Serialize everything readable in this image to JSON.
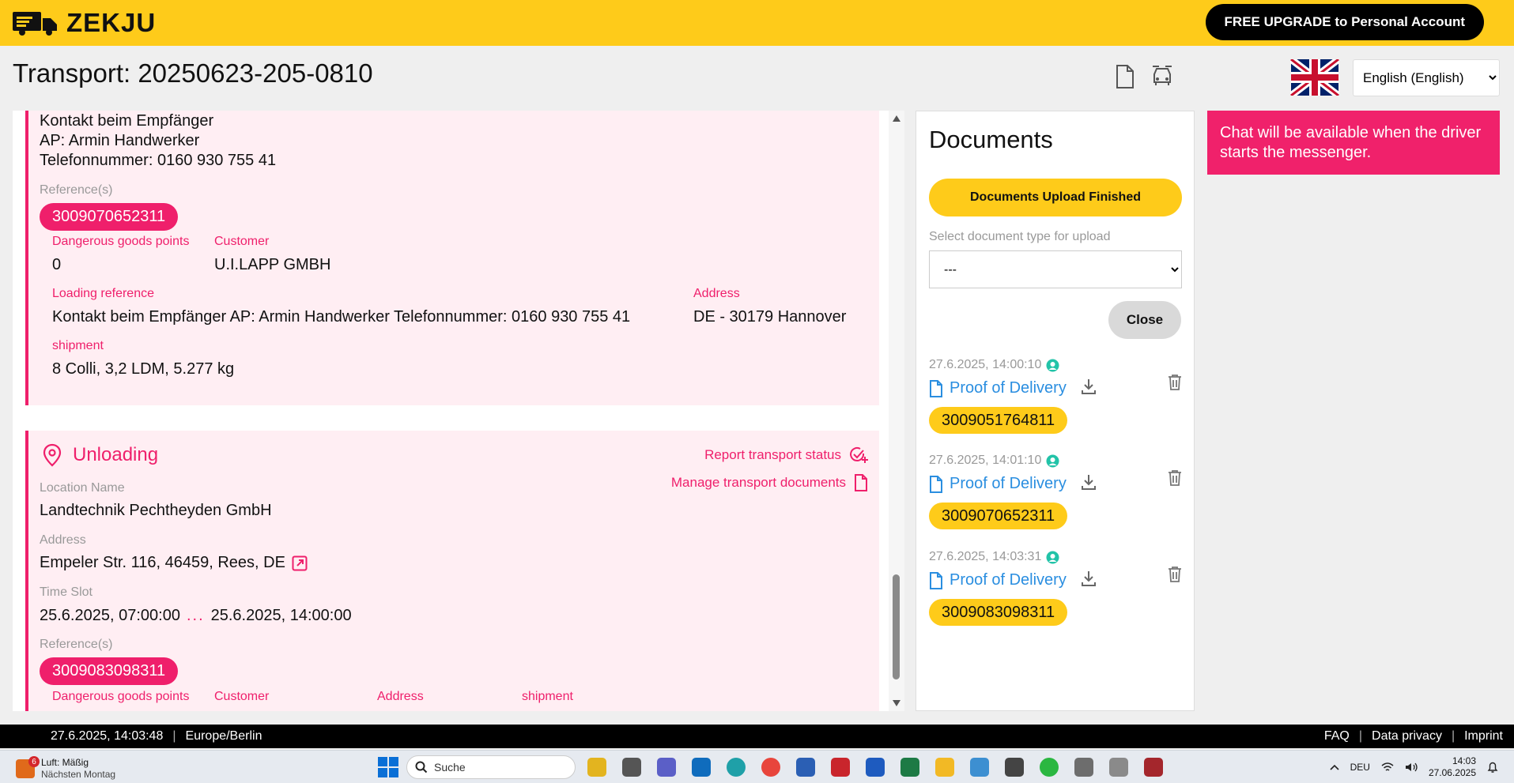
{
  "app": {
    "logo_text": "ZEKJU",
    "upgrade_button": "FREE UPGRADE to Personal Account"
  },
  "header": {
    "title": "Transport: 20250623-205-0810",
    "language": "English (English)"
  },
  "loading_card": {
    "contact_line1": "Kontakt beim Empfänger",
    "contact_line2": "AP: Armin Handwerker",
    "contact_line3": "Telefonnummer: 0160 930 755 41",
    "references_label": "Reference(s)",
    "reference": "3009070652311",
    "dangerous_goods_label": "Dangerous goods points",
    "dangerous_goods_value": "0",
    "customer_label": "Customer",
    "customer_value": "U.I.LAPP GMBH",
    "loading_reference_label": "Loading reference",
    "loading_reference_value": "Kontakt beim Empfänger AP: Armin Handwerker Telefonnummer: 0160 930 755 41",
    "address_label": "Address",
    "address_value": "DE - 30179 Hannover",
    "shipment_label": "shipment",
    "shipment_value": "8 Colli, 3,2 LDM, 5.277 kg"
  },
  "unloading_card": {
    "title": "Unloading",
    "report_status": "Report transport status",
    "manage_documents": "Manage transport documents",
    "location_name_label": "Location Name",
    "location_name": "Landtechnik Pechtheyden GmbH",
    "address_label": "Address",
    "address": "Empeler Str. 116, 46459, Rees, DE",
    "time_slot_label": "Time Slot",
    "time_start": "25.6.2025, 07:00:00",
    "time_sep": "...",
    "time_end": "25.6.2025, 14:00:00",
    "references_label": "Reference(s)",
    "reference": "3009083098311",
    "dangerous_goods_label": "Dangerous goods points",
    "customer_label": "Customer",
    "address_col_label": "Address",
    "shipment_label": "shipment"
  },
  "documents": {
    "title": "Documents",
    "upload_finished_button": "Documents Upload Finished",
    "select_label": "Select document type for upload",
    "select_value": "---",
    "close_button": "Close",
    "items": [
      {
        "time": "27.6.2025, 14:00:10",
        "name": "Proof of Delivery",
        "reference": "3009051764811"
      },
      {
        "time": "27.6.2025, 14:01:10",
        "name": "Proof of Delivery",
        "reference": "3009070652311"
      },
      {
        "time": "27.6.2025, 14:03:31",
        "name": "Proof of Delivery",
        "reference": "3009083098311"
      }
    ]
  },
  "chat": {
    "notice": "Chat will be available when the driver starts the messenger."
  },
  "footer": {
    "datetime": "27.6.2025, 14:03:48",
    "timezone": "Europe/Berlin",
    "faq": "FAQ",
    "privacy": "Data privacy",
    "imprint": "Imprint"
  },
  "taskbar": {
    "weather_badge": "6",
    "weather_line1": "Luft: Mäßig",
    "weather_line2": "Nächsten Montag",
    "search_placeholder": "Suche",
    "language": "DEU",
    "time": "14:03",
    "date": "27.06.2025"
  },
  "colors": {
    "brand_yellow": "#fecb1a",
    "accent_pink": "#ef1f6b",
    "link_blue": "#2a8ee0"
  }
}
